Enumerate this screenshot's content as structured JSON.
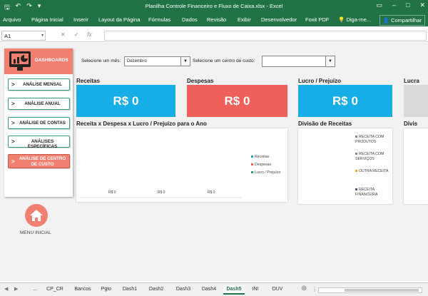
{
  "window": {
    "title": "Planilha Controle Financeiro e Fluxo de Caixa.xlsx - Excel"
  },
  "ribbon": {
    "tabs": [
      "Arquivo",
      "Página Inicial",
      "Inserir",
      "Layout da Página",
      "Fórmulas",
      "Dados",
      "Revisão",
      "Exibir",
      "Desenvolvedor",
      "Foxit PDF"
    ],
    "tell_me": "Diga-me...",
    "share": "Compartilhar"
  },
  "formula_bar": {
    "name_box": "A1",
    "fx": "fx"
  },
  "sidebar": {
    "header": "DASHBOARDS",
    "items": [
      {
        "label": "ANÁLISE MENSAL"
      },
      {
        "label": "ANÁLISE ANUAL"
      },
      {
        "label": "ANÁLISE DE CONTAS"
      },
      {
        "label": "ANÁLISES ESPECÍFICAS"
      },
      {
        "label": "ANÁLISE DE CENTRO DE CUSTO"
      }
    ],
    "home_label": "MENU INICIAL"
  },
  "filters": {
    "month_label": "Selecione um mês:",
    "month_value": "Dezembro",
    "cost_center_label": "Selecione um centro de custo:",
    "cost_center_value": ""
  },
  "cards": {
    "receitas": {
      "title": "Receitas",
      "value": "R$ 0"
    },
    "despesas": {
      "title": "Despesas",
      "value": "R$ 0"
    },
    "lucro": {
      "title": "Lucro / Prejuízo",
      "value": "R$ 0"
    },
    "lucro_cut": {
      "title": "Lucra"
    }
  },
  "chart_main": {
    "title": "Receita x Despesa x Lucro / Prejuízo para o Ano"
  },
  "chart_div": {
    "title": "Divisão de Receitas"
  },
  "chart_div_cut": {
    "title": "Divis"
  },
  "chart_data": [
    {
      "type": "bar",
      "title": "Receita x Despesa x Lucro / Prejuízo para o Ano",
      "categories": [
        ""
      ],
      "series": [
        {
          "name": "Receitas",
          "values": [
            0
          ]
        },
        {
          "name": "Despesas",
          "values": [
            0
          ]
        },
        {
          "name": "Lucro / Prejuízo",
          "values": [
            0
          ]
        }
      ],
      "data_labels": [
        "R$ 0",
        "R$ 0",
        "R$ 0"
      ],
      "legend": "right",
      "colors": [
        "#1fa9a0",
        "#f05a5a",
        "#2ca25f"
      ]
    },
    {
      "type": "pie",
      "title": "Divisão de Receitas",
      "categories": [
        "RECEITA COM PRODUTOS",
        "RECEITA COM SERVIÇOS",
        "OUTRA RECEITA",
        "RECEITA FINANCEIRA"
      ],
      "values": [
        0,
        0,
        0,
        0
      ],
      "legend": "right",
      "colors": [
        "#888888",
        "#888888",
        "#f0b400",
        "#555577"
      ]
    }
  ],
  "sheet_tabs": {
    "ellipsis": "...",
    "tabs": [
      "CP_CR",
      "Bancos",
      "Pgto",
      "Dash1",
      "Dash2",
      "Dash3",
      "Dash4",
      "Dash5",
      "INI",
      "DUV"
    ],
    "active": "Dash5"
  },
  "colors": {
    "excel_green": "#217346",
    "kpi_blue": "#17aee8",
    "kpi_red": "#f0605a",
    "accent_salmon": "#f28070"
  }
}
